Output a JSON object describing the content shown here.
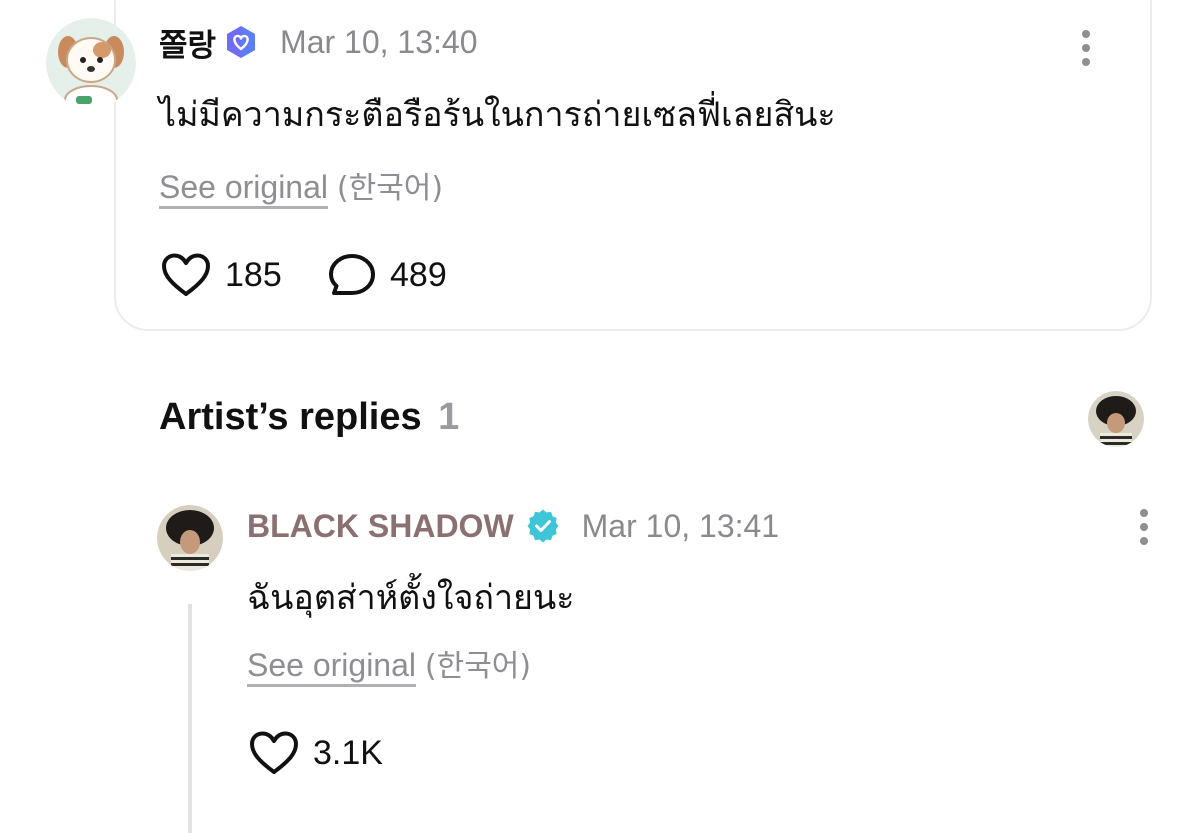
{
  "post": {
    "author": "쫄랑",
    "time": "Mar 10, 13:40",
    "text": "ไม่มีความกระตือรือร้นในการถ่ายเซลฟี่เลยสินะ",
    "see_original": "See original",
    "language": "(한국어)",
    "likes": "185",
    "comments": "489",
    "badge_color": "#6f6cf6"
  },
  "replies_section": {
    "title": "Artist’s replies",
    "count": "1"
  },
  "reply": {
    "author": "BLACK SHADOW",
    "author_color": "#8a7070",
    "time": "Mar 10, 13:41",
    "text": "ฉันอุตส่าห์ตั้งใจถ่ายนะ",
    "see_original": "See original",
    "language": "(한국어)",
    "likes": "3.1K",
    "badge_color": "#3ec6d6"
  }
}
